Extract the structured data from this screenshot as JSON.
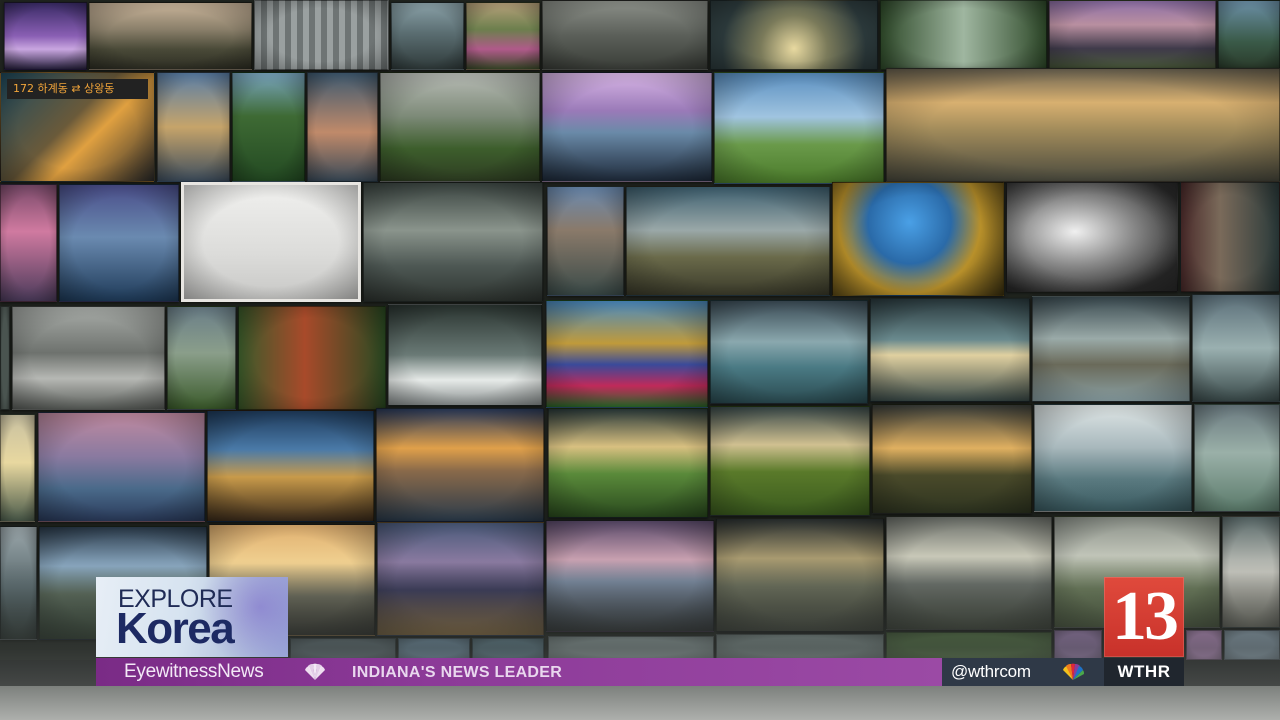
{
  "graphic": {
    "explore_top": "EXPLORE",
    "explore_main": "Korea"
  },
  "ticker": {
    "brand": "EyewitnessNews",
    "slogan": "INDIANA'S NEWS LEADER",
    "handle": "@wthrcom"
  },
  "station": {
    "number": "13",
    "call_letters": "WTHR"
  },
  "bus_sign": "172 하계동 ⇄ 상왕동",
  "colors": {
    "ticker_purple": "#8c3a98",
    "social_bar": "#2f3947",
    "logo_red": "#d63b31",
    "explore_navy": "#1d2a63"
  },
  "icons": [
    "peacock-icon",
    "peacock-icon"
  ]
}
